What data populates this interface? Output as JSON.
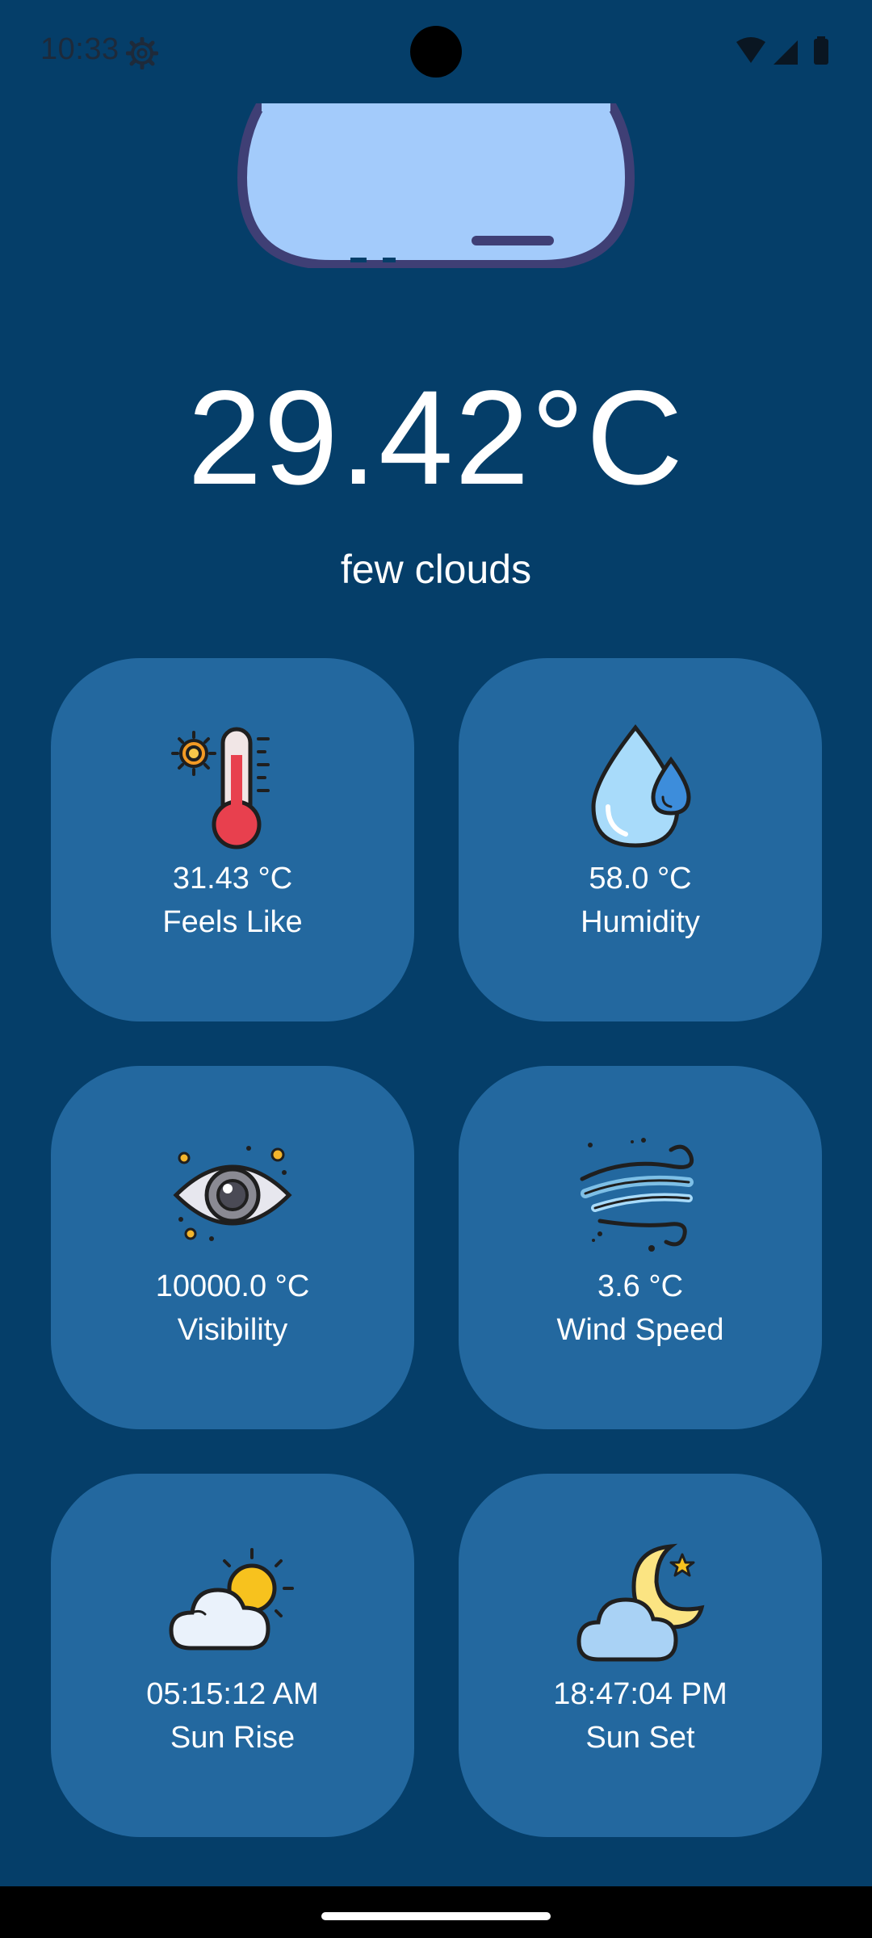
{
  "status_bar": {
    "time": "10:33"
  },
  "weather": {
    "temperature": "29.42°C",
    "description": "few clouds"
  },
  "cards": [
    {
      "value": "31.43 °C",
      "label": "Feels Like",
      "icon": "thermometer-sun-icon"
    },
    {
      "value": "58.0 °C",
      "label": "Humidity",
      "icon": "water-drops-icon"
    },
    {
      "value": "10000.0 °C",
      "label": "Visibility",
      "icon": "eye-icon"
    },
    {
      "value": "3.6 °C",
      "label": "Wind Speed",
      "icon": "wind-icon"
    },
    {
      "value": "05:15:12 AM",
      "label": "Sun Rise",
      "icon": "cloud-sun-icon"
    },
    {
      "value": "18:47:04 PM",
      "label": "Sun Set",
      "icon": "cloud-moon-icon"
    }
  ],
  "colors": {
    "background": "#053E69",
    "card": "#23689F",
    "text": "#FFFFFF"
  }
}
